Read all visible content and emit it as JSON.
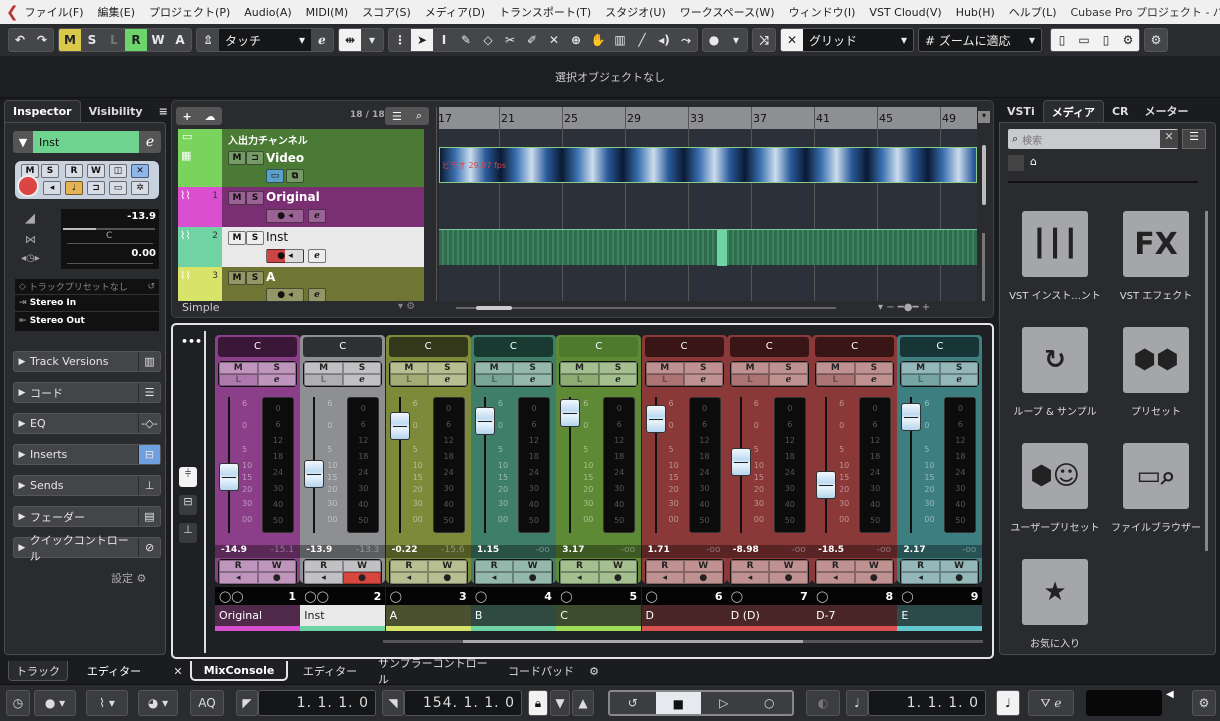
{
  "menubar": {
    "items": [
      "ファイル(F)",
      "編集(E)",
      "プロジェクト(P)",
      "Audio(A)",
      "MIDI(M)",
      "スコア(S)",
      "メディア(D)",
      "トランスポート(T)",
      "スタジオ(U)",
      "ワークスペース(W)",
      "ウィンドウ(I)",
      "VST Cloud(V)",
      "Hub(H)",
      "ヘルプ(L)"
    ],
    "window_title": "Cubase Pro プロジェクト - ハイドアンド・シーク...",
    "restore_icon": "❐",
    "close_icon": "✕"
  },
  "toolbar": {
    "undo": "↶",
    "redo": "↷",
    "state_buttons": [
      "M",
      "S",
      "L",
      "R",
      "W",
      "A"
    ],
    "automation_mode": "タッチ",
    "snap_type": "グリッド",
    "quantize": "ズームに適応"
  },
  "infoline": {
    "text": "選択オブジェクトなし"
  },
  "inspector": {
    "tabs": [
      "Inspector",
      "Visibility"
    ],
    "track_name": "Inst",
    "buttons": {
      "m": "M",
      "s": "S",
      "r": "R",
      "w": "W"
    },
    "volume": "-13.9",
    "pan": "C",
    "delay": "0.00",
    "preset": "トラックプリセットなし",
    "input": "Stereo In",
    "output": "Stereo Out",
    "sections": [
      {
        "label": "Track Versions",
        "icon": "versions-icon",
        "glyph": "▥"
      },
      {
        "label": "コード",
        "icon": "chord-icon",
        "glyph": "☰"
      },
      {
        "label": "EQ",
        "icon": "eq-icon",
        "glyph": "-◇-"
      },
      {
        "label": "Inserts",
        "icon": "inserts-icon",
        "glyph": "⊟"
      },
      {
        "label": "Sends",
        "icon": "sends-icon",
        "glyph": "⊥"
      },
      {
        "label": "フェーダー",
        "icon": "fader-icon",
        "glyph": "▤"
      },
      {
        "label": "クイックコントロール",
        "icon": "quick-control-icon",
        "glyph": "⊘"
      }
    ],
    "settings_label": "設定"
  },
  "project": {
    "track_count": "18 / 18",
    "preset_label": "Simple",
    "tracks": [
      {
        "name": "入出力チャンネル",
        "num": "",
        "type": "folder"
      },
      {
        "name": "Video",
        "num": "",
        "type": "video"
      },
      {
        "name": "Original",
        "num": "1",
        "type": "audio"
      },
      {
        "name": "Inst",
        "num": "2",
        "type": "audio"
      },
      {
        "name": "A",
        "num": "3",
        "type": "audio"
      }
    ],
    "ruler": [
      "17",
      "21",
      "25",
      "29",
      "33",
      "37",
      "41",
      "45",
      "49"
    ],
    "video_overlay": "ビデオ 29.97 fps"
  },
  "mixer": {
    "channels": [
      {
        "num": "1",
        "name": "Original",
        "pan": "C",
        "vol": "-14.9",
        "peak": "-15.1",
        "fader_db": -14.9,
        "color": "#8a3f88",
        "hdr": "#3b1737",
        "strip": "#d94fcf",
        "name_bg": "#4f2a4b",
        "write_on": false
      },
      {
        "num": "2",
        "name": "Inst",
        "pan": "C",
        "vol": "-13.9",
        "peak": "-13.3",
        "fader_db": -13.9,
        "color": "#8e8f93",
        "hdr": "#2f3033",
        "strip": "#6fd3a4",
        "name_bg": "#e9e9e9",
        "write_on": true
      },
      {
        "num": "3",
        "name": "A",
        "pan": "C",
        "vol": "-0.22",
        "peak": "-15.6",
        "fader_db": -0.22,
        "color": "#7d8a3a",
        "hdr": "#34381b",
        "strip": "#d8e36a",
        "name_bg": "#4a5030",
        "write_on": false
      },
      {
        "num": "4",
        "name": "B",
        "pan": "C",
        "vol": "1.15",
        "peak": "-oo",
        "fader_db": 1.15,
        "color": "#3f7f6a",
        "hdr": "#183a31",
        "strip": "#6fd3a4",
        "name_bg": "#2f4a40",
        "write_on": false
      },
      {
        "num": "5",
        "name": "C",
        "pan": "C",
        "vol": "3.17",
        "peak": "-oo",
        "fader_db": 3.17,
        "color": "#5e8a36",
        "hdr": "#4d7a2c",
        "strip": "#9ddc55",
        "name_bg": "#3b4d2c",
        "write_on": false
      },
      {
        "num": "6",
        "name": "D",
        "pan": "C",
        "vol": "1.71",
        "peak": "-oo",
        "fader_db": 1.71,
        "color": "#8a3838",
        "hdr": "#3a1515",
        "strip": "#d95050",
        "name_bg": "#4a2626",
        "write_on": false
      },
      {
        "num": "7",
        "name": "D (D)",
        "pan": "C",
        "vol": "-8.98",
        "peak": "-oo",
        "fader_db": -8.98,
        "color": "#8a3838",
        "hdr": "#3a1515",
        "strip": "#d95050",
        "name_bg": "#4a2626",
        "write_on": false
      },
      {
        "num": "8",
        "name": "D-7",
        "pan": "C",
        "vol": "-18.5",
        "peak": "-oo",
        "fader_db": -18.5,
        "color": "#8a3838",
        "hdr": "#3a1515",
        "strip": "#d95050",
        "name_bg": "#4a2626",
        "write_on": false
      },
      {
        "num": "9",
        "name": "E",
        "pan": "C",
        "vol": "2.17",
        "peak": "-oo",
        "fader_db": 2.17,
        "color": "#3d7f80",
        "hdr": "#173536",
        "strip": "#63c9cf",
        "name_bg": "#2c4a4b",
        "write_on": false
      }
    ],
    "fader_scale": [
      "6",
      "0",
      "5",
      "10",
      "15",
      "20",
      "30",
      "00"
    ],
    "meter_scale": [
      "0",
      "6",
      "12",
      "18",
      "24",
      "30",
      "40",
      "50"
    ]
  },
  "media": {
    "tabs": [
      "VSTi",
      "メディア",
      "CR",
      "メーター"
    ],
    "search_placeholder": "検索",
    "tiles": [
      {
        "label": "VST インスト...ント",
        "icon": "piano-icon"
      },
      {
        "label": "VST エフェクト",
        "icon": "fx-icon",
        "glyph": "FX"
      },
      {
        "label": "ループ & サンプル",
        "icon": "loop-icon"
      },
      {
        "label": "プリセット",
        "icon": "preset-icon"
      },
      {
        "label": "ユーザープリセット",
        "icon": "user-preset-icon"
      },
      {
        "label": "ファイルブラウザー",
        "icon": "file-browser-icon"
      },
      {
        "label": "お気に入り",
        "icon": "star-icon"
      }
    ]
  },
  "bottom_tabs": {
    "left": [
      "トラック",
      "エディター"
    ],
    "lower": [
      "MixConsole",
      "エディター",
      "サンプラーコントロール",
      "コードパッド"
    ]
  },
  "transport": {
    "aq": "AQ",
    "left_locator": "1. 1. 1.   0",
    "right_locator": "154. 1. 1.   0",
    "position": "1. 1. 1.   0"
  }
}
